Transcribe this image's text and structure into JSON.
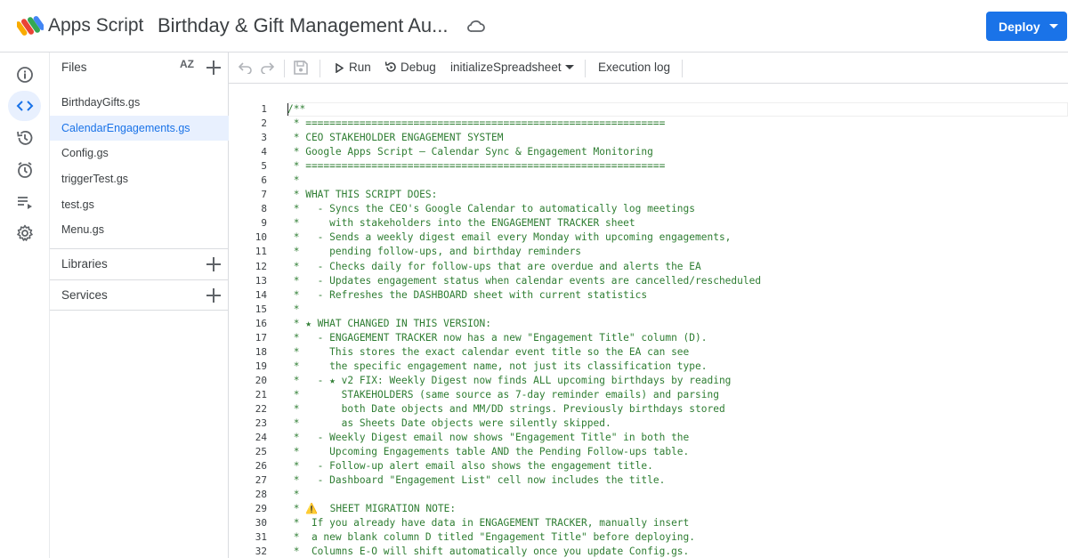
{
  "header": {
    "app_name": "Apps Script",
    "project_title": "Birthday & Gift Management Au...",
    "deploy_label": "Deploy",
    "brand_color": "#1a73e8"
  },
  "rail": {
    "items": [
      "overview-icon",
      "editor-icon",
      "history-icon",
      "triggers-icon",
      "executions-icon",
      "settings-icon"
    ],
    "active": "editor-icon"
  },
  "files_panel": {
    "title": "Files",
    "sort_label": "AZ",
    "files": [
      {
        "name": "BirthdayGifts.gs",
        "active": false
      },
      {
        "name": "CalendarEngagements.gs",
        "active": true
      },
      {
        "name": "Config.gs",
        "active": false
      },
      {
        "name": "triggerTest.gs",
        "active": false
      },
      {
        "name": "test.gs",
        "active": false
      },
      {
        "name": "Menu.gs",
        "active": false
      }
    ],
    "libraries_label": "Libraries",
    "services_label": "Services"
  },
  "toolbar": {
    "run_label": "Run",
    "debug_label": "Debug",
    "function_selected": "initializeSpreadsheet",
    "execution_log_label": "Execution log"
  },
  "editor": {
    "lines": [
      "/**",
      " * ============================================================",
      " * CEO STAKEHOLDER ENGAGEMENT SYSTEM",
      " * Google Apps Script — Calendar Sync & Engagement Monitoring",
      " * ============================================================",
      " *",
      " * WHAT THIS SCRIPT DOES:",
      " *   - Syncs the CEO's Google Calendar to automatically log meetings",
      " *     with stakeholders into the ENGAGEMENT TRACKER sheet",
      " *   - Sends a weekly digest email every Monday with upcoming engagements,",
      " *     pending follow-ups, and birthday reminders",
      " *   - Checks daily for follow-ups that are overdue and alerts the EA",
      " *   - Updates engagement status when calendar events are cancelled/rescheduled",
      " *   - Refreshes the DASHBOARD sheet with current statistics",
      " *",
      " * ★ WHAT CHANGED IN THIS VERSION:",
      " *   - ENGAGEMENT TRACKER now has a new \"Engagement Title\" column (D).",
      " *     This stores the exact calendar event title so the EA can see",
      " *     the specific engagement name, not just its classification type.",
      " *   - ★ v2 FIX: Weekly Digest now finds ALL upcoming birthdays by reading",
      " *       STAKEHOLDERS (same source as 7-day reminder emails) and parsing",
      " *       both Date objects and MM/DD strings. Previously birthdays stored",
      " *       as Sheets Date objects were silently skipped.",
      " *   - Weekly Digest email now shows \"Engagement Title\" in both the",
      " *     Upcoming Engagements table AND the Pending Follow-ups table.",
      " *   - Follow-up alert email also shows the engagement title.",
      " *   - Dashboard \"Engagement List\" cell now includes the title.",
      " *",
      " * ⚠️  SHEET MIGRATION NOTE:",
      " *  If you already have data in ENGAGEMENT TRACKER, manually insert",
      " *  a new blank column D titled \"Engagement Title\" before deploying.",
      " *  Columns E-O will shift automatically once you update Config.gs."
    ]
  }
}
